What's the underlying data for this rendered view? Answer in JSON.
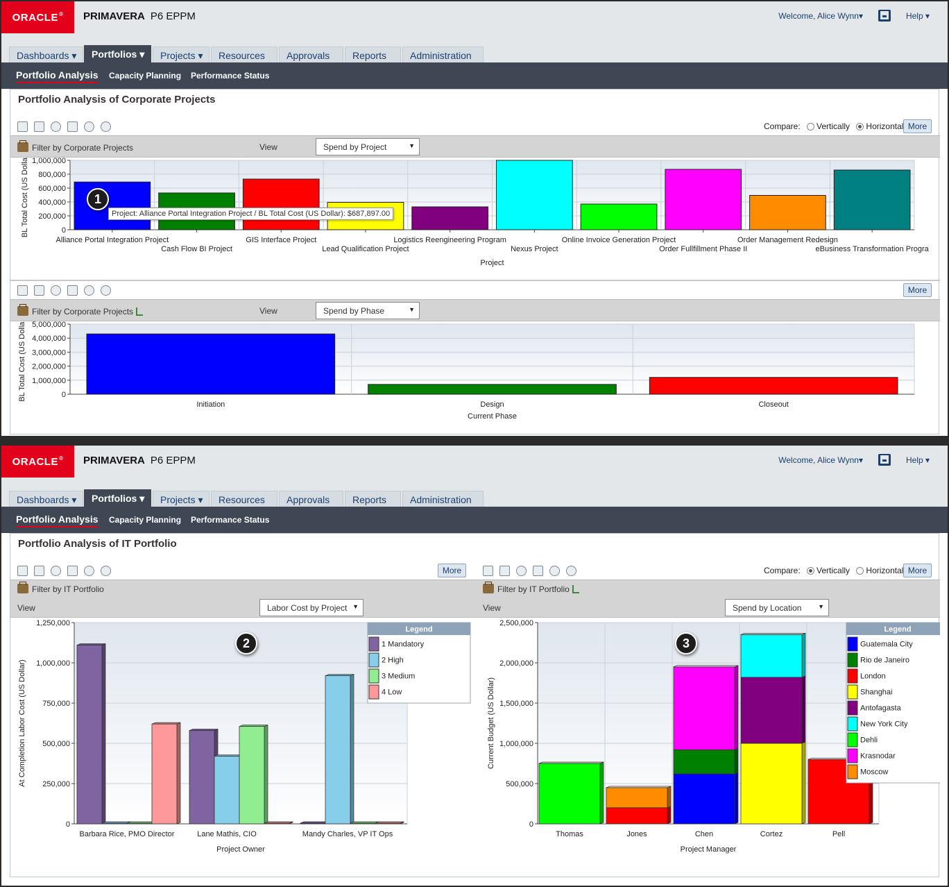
{
  "app": {
    "logo": "ORACLE",
    "logo_reg": "®",
    "brand": "PRIMAVERA",
    "product": "P6 EPPM",
    "welcome": "Welcome, Alice Wynn▾",
    "help": "Help ▾"
  },
  "tabs": [
    "Dashboards ▾",
    "Portfolios ▾",
    "Projects ▾",
    "Resources",
    "Approvals",
    "Reports",
    "Administration"
  ],
  "subnav": [
    "Portfolio Analysis",
    "Capacity Planning",
    "Performance Status"
  ],
  "compare": {
    "label": "Compare:",
    "vertical": "Vertically",
    "horizontal": "Horizontally"
  },
  "more_label": "More",
  "view_label": "View",
  "top": {
    "title": "Portfolio Analysis of Corporate Projects",
    "filter1": "Filter by Corporate Projects",
    "filter2": "Filter by Corporate Projects",
    "view1": "Spend by Project",
    "view2": "Spend by Phase",
    "tooltip": "Project: Alliance Portal Integration Project / BL Total Cost (US Dollar): $687,897.00"
  },
  "bottom": {
    "title": "Portfolio Analysis of IT Portfolio",
    "filter_left": "Filter by IT Portfolio",
    "filter_right": "Filter by IT Portfolio",
    "view_left": "Labor Cost by Project",
    "view_right": "Spend by Location"
  },
  "badges": [
    "1",
    "2",
    "3"
  ],
  "chart_data": [
    {
      "type": "bar",
      "ylabel": "BL Total Cost (US Dollar)",
      "xlabel": "Project",
      "ylim": [
        0,
        1000000
      ],
      "yticks": [
        "0",
        "200,000",
        "400,000",
        "600,000",
        "800,000",
        "1,000,000"
      ],
      "categories": [
        "Alliance Portal Integration Project",
        "Cash Flow BI Project",
        "GIS Interface Project",
        "Lead Qualification Project",
        "Logistics Reengineering Program",
        "Nexus Project",
        "Online Invoice Generation Project",
        "Order Fullfillment Phase II",
        "Order Management Redesign",
        "eBusiness Transformation Progra"
      ],
      "values": [
        687897,
        530000,
        730000,
        395000,
        330000,
        1000000,
        370000,
        870000,
        495000,
        860000
      ],
      "colors": [
        "#0000ff",
        "#008000",
        "#ff0000",
        "#ffff00",
        "#800080",
        "#00ffff",
        "#00ff00",
        "#ff00ff",
        "#ff8c00",
        "#008080"
      ]
    },
    {
      "type": "bar",
      "ylabel": "BL Total Cost (US Dollar)",
      "xlabel": "Current Phase",
      "ylim": [
        0,
        5000000
      ],
      "yticks": [
        "0",
        "1,000,000",
        "2,000,000",
        "3,000,000",
        "4,000,000",
        "5,000,000"
      ],
      "categories": [
        "Initiation",
        "Design",
        "Closeout"
      ],
      "values": [
        4300000,
        700000,
        1200000
      ],
      "colors": [
        "#0000ff",
        "#008000",
        "#ff0000"
      ]
    },
    {
      "type": "bar",
      "ylabel": "At Completion Labor Cost (US Dollar)",
      "xlabel": "Project Owner",
      "ylim": [
        0,
        1250000
      ],
      "yticks": [
        "0",
        "250,000",
        "500,000",
        "750,000",
        "1,000,000",
        "1,250,000"
      ],
      "categories": [
        "Barbara Rice, PMO Director",
        "Lane Mathis, CIO",
        "Mandy Charles, VP IT Ops"
      ],
      "legend_title": "Legend",
      "series": [
        {
          "name": "1 Mandatory",
          "color": "#8064a2",
          "values": [
            1110000,
            580000,
            0
          ]
        },
        {
          "name": "2 High",
          "color": "#87ceeb",
          "values": [
            0,
            420000,
            920000
          ]
        },
        {
          "name": "3 Medium",
          "color": "#90ee90",
          "values": [
            0,
            605000,
            0
          ]
        },
        {
          "name": "4 Low",
          "color": "#ff9999",
          "values": [
            620000,
            0,
            0
          ]
        }
      ]
    },
    {
      "type": "bar",
      "stacked": true,
      "ylabel": "Current Budget (US Dollar)",
      "xlabel": "Project Manager",
      "ylim": [
        0,
        2500000
      ],
      "yticks": [
        "0",
        "500,000",
        "1,000,000",
        "1,500,000",
        "2,000,000",
        "2,500,000"
      ],
      "categories": [
        "Thomas",
        "Jones",
        "Chen",
        "Cortez",
        "Pell"
      ],
      "legend_title": "Legend",
      "series": [
        {
          "name": "Guatemala City",
          "color": "#0000ff",
          "values": [
            0,
            0,
            620000,
            0,
            0
          ]
        },
        {
          "name": "Rio de Janeiro",
          "color": "#008000",
          "values": [
            0,
            0,
            300000,
            0,
            0
          ]
        },
        {
          "name": "London",
          "color": "#ff0000",
          "values": [
            0,
            200000,
            0,
            0,
            800000
          ]
        },
        {
          "name": "Shanghai",
          "color": "#ffff00",
          "values": [
            0,
            0,
            0,
            1000000,
            0
          ]
        },
        {
          "name": "Antofagasta",
          "color": "#800080",
          "values": [
            0,
            0,
            0,
            820000,
            0
          ]
        },
        {
          "name": "New York City",
          "color": "#00ffff",
          "values": [
            0,
            0,
            0,
            530000,
            0
          ]
        },
        {
          "name": "Dehli",
          "color": "#00ff00",
          "values": [
            750000,
            0,
            0,
            0,
            0
          ]
        },
        {
          "name": "Krasnodar",
          "color": "#ff00ff",
          "values": [
            0,
            0,
            1030000,
            0,
            0
          ]
        },
        {
          "name": "Moscow",
          "color": "#ff8c00",
          "values": [
            0,
            250000,
            0,
            0,
            0
          ]
        }
      ]
    }
  ]
}
